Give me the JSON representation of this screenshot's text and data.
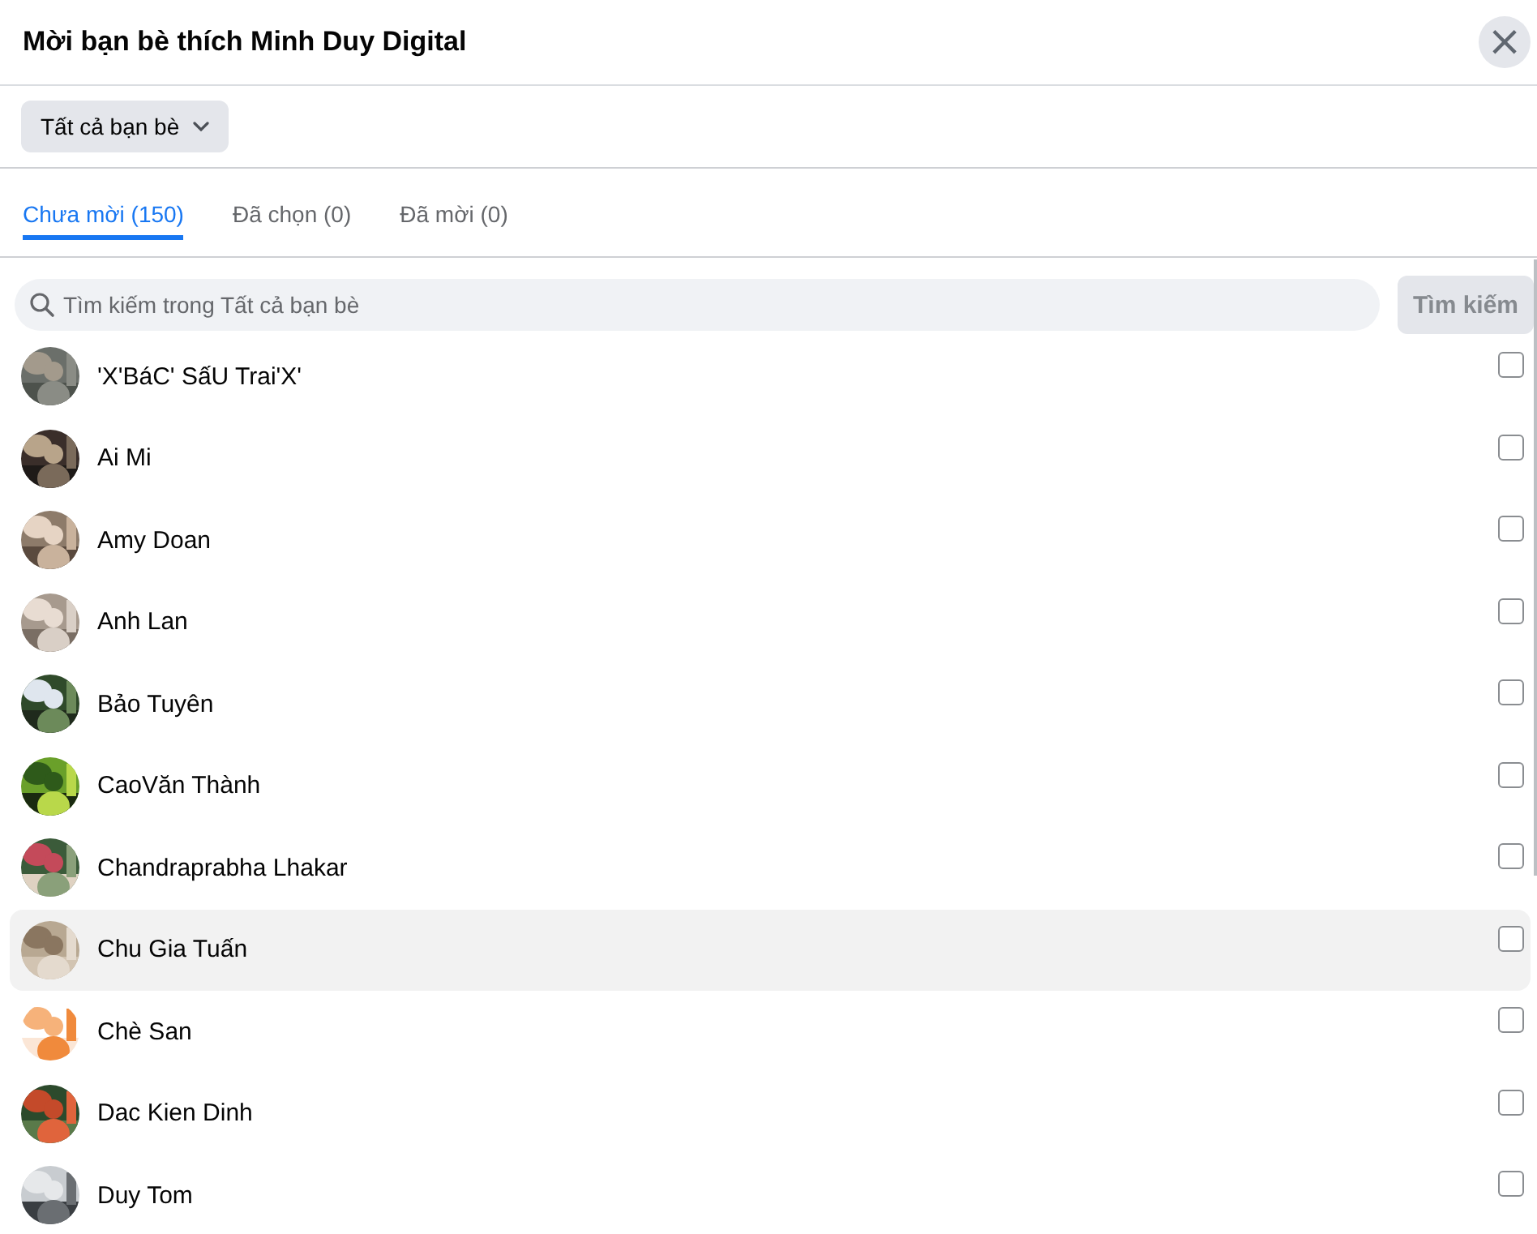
{
  "dialog": {
    "title": "Mời bạn bè thích Minh Duy Digital",
    "close": "×"
  },
  "filter": {
    "label": "Tất cả bạn bè"
  },
  "tabs": [
    {
      "label": "Chưa mời (150)",
      "selected": true
    },
    {
      "label": "Đã chọn (0)",
      "selected": false
    },
    {
      "label": "Đã mời (0)",
      "selected": false
    }
  ],
  "search": {
    "placeholder": "Tìm kiếm trong Tất cả bạn bè",
    "button": "Tìm kiếm",
    "button_disabled": true
  },
  "friends": [
    {
      "name": "'X'BáC' SấU Trai'X'",
      "checked": false,
      "highlighted": false
    },
    {
      "name": "Ai Mi",
      "checked": false,
      "highlighted": false
    },
    {
      "name": "Amy Doan",
      "checked": false,
      "highlighted": false
    },
    {
      "name": "Anh Lan",
      "checked": false,
      "highlighted": false
    },
    {
      "name": "Bảo Tuyên",
      "checked": false,
      "highlighted": false
    },
    {
      "name": "CaoVăn Thành",
      "checked": false,
      "highlighted": false
    },
    {
      "name": "Chandraprabha Lhakar",
      "checked": false,
      "highlighted": false
    },
    {
      "name": "Chu Gia Tuấn",
      "checked": false,
      "highlighted": true
    },
    {
      "name": "Chè San",
      "checked": false,
      "highlighted": false
    },
    {
      "name": "Dac Kien Dinh",
      "checked": false,
      "highlighted": false
    },
    {
      "name": "Duy Tom",
      "checked": false,
      "highlighted": false
    }
  ]
}
